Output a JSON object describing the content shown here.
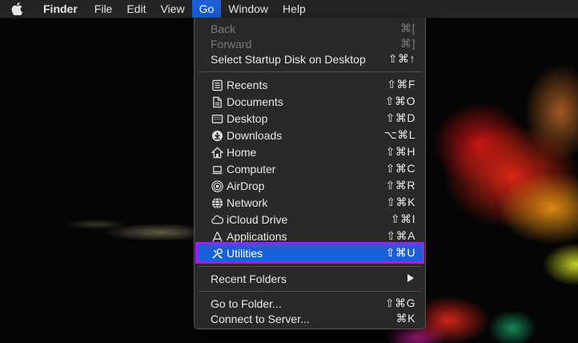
{
  "menubar": {
    "app_name": "Finder",
    "items": [
      "File",
      "Edit",
      "View",
      "Go",
      "Window",
      "Help"
    ],
    "active": "Go"
  },
  "go_menu": {
    "back": {
      "label": "Back",
      "shortcut": "⌘["
    },
    "forward": {
      "label": "Forward",
      "shortcut": "⌘]"
    },
    "startup": {
      "label": "Select Startup Disk on Desktop",
      "shortcut": "⇧⌘↑"
    },
    "recents": {
      "label": "Recents",
      "shortcut": "⇧⌘F"
    },
    "documents": {
      "label": "Documents",
      "shortcut": "⇧⌘O"
    },
    "desktop": {
      "label": "Desktop",
      "shortcut": "⇧⌘D"
    },
    "downloads": {
      "label": "Downloads",
      "shortcut": "⌥⌘L"
    },
    "home": {
      "label": "Home",
      "shortcut": "⇧⌘H"
    },
    "computer": {
      "label": "Computer",
      "shortcut": "⇧⌘C"
    },
    "airdrop": {
      "label": "AirDrop",
      "shortcut": "⇧⌘R"
    },
    "network": {
      "label": "Network",
      "shortcut": "⇧⌘K"
    },
    "icloud": {
      "label": "iCloud Drive",
      "shortcut": "⇧⌘I"
    },
    "applications": {
      "label": "Applications",
      "shortcut": "⇧⌘A"
    },
    "utilities": {
      "label": "Utilities",
      "shortcut": "⇧⌘U"
    },
    "recent_folders": {
      "label": "Recent Folders"
    },
    "go_to_folder": {
      "label": "Go to Folder...",
      "shortcut": "⇧⌘G"
    },
    "connect": {
      "label": "Connect to Server...",
      "shortcut": "⌘K"
    }
  },
  "colors": {
    "highlight": "#1a5fd8",
    "annotation_outline": "#a41cf0",
    "menubar_bg": "#242424",
    "menu_bg": "#2a2a2a"
  }
}
